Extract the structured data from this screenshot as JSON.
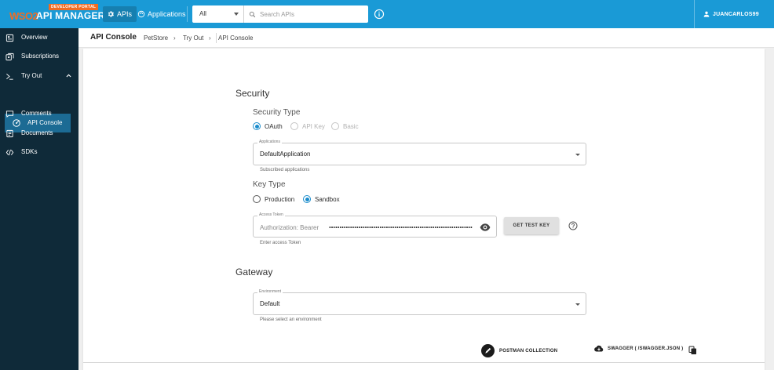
{
  "header": {
    "brand": {
      "badge": "DEVELOPER PORTAL",
      "wso2": "WSO2",
      "product": "API MANAGER"
    },
    "nav": {
      "apis_label": "APIs",
      "applications_label": "Applications"
    },
    "search": {
      "scope_value": "All",
      "placeholder": "Search APIs"
    },
    "user": {
      "name": "JUANCARLOS99"
    },
    "colors": {
      "bar": "#1a9ad6",
      "brand_accent": "#f36c21"
    }
  },
  "sidebar": {
    "items": [
      {
        "label": "Overview",
        "icon": "overview-icon"
      },
      {
        "label": "Subscriptions",
        "icon": "subscriptions-icon"
      },
      {
        "label": "Try Out",
        "icon": "terminal-icon",
        "expanded": true
      },
      {
        "label": "API Console",
        "icon": "api-console-icon",
        "selected": true
      },
      {
        "label": "Comments",
        "icon": "comments-icon"
      },
      {
        "label": "Documents",
        "icon": "documents-icon"
      },
      {
        "label": "SDKs",
        "icon": "code-icon"
      }
    ],
    "colors": {
      "background": "#0f2a39",
      "selected": "#1c6b94"
    }
  },
  "breadcrumb": {
    "title": "API Console",
    "items": [
      "PetStore",
      "Try Out",
      "API Console"
    ]
  },
  "security": {
    "heading": "Security",
    "type_heading": "Security Type",
    "types": [
      {
        "label": "OAuth",
        "selected": true,
        "enabled": true
      },
      {
        "label": "API Key",
        "selected": false,
        "enabled": false
      },
      {
        "label": "Basic",
        "selected": false,
        "enabled": false
      }
    ],
    "applications": {
      "label": "Applications",
      "value": "DefaultApplication",
      "helper": "Subscribed applications"
    },
    "key_type_heading": "Key Type",
    "key_types": [
      {
        "label": "Production",
        "selected": false
      },
      {
        "label": "Sandbox",
        "selected": true
      }
    ],
    "access_token": {
      "label": "Access Token",
      "prefix": "Authorization: Bearer",
      "helper": "Enter access Token"
    },
    "get_test_key_label": "GET TEST KEY"
  },
  "gateway": {
    "heading": "Gateway",
    "environment": {
      "label": "Environment",
      "value": "Default",
      "helper": "Please select an environment"
    }
  },
  "downloads": {
    "postman_label": "POSTMAN COLLECTION",
    "swagger_label": "SWAGGER ( /SWAGGER.JSON )"
  }
}
